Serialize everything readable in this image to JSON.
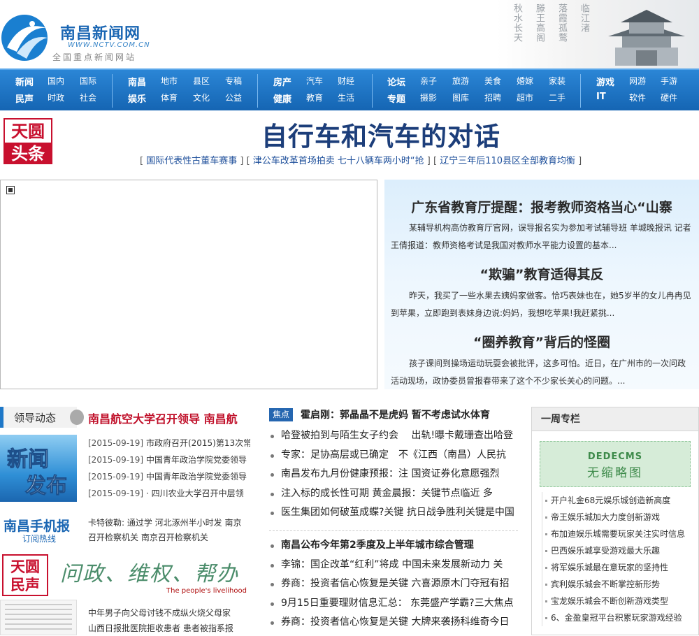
{
  "header": {
    "site_name": "南昌新闻网",
    "site_url": "WWW.NCTV.COM.CN",
    "slogan": "全国重点新闻网站",
    "banner_calligraphy": [
      "秋水长天",
      "滕王高阁",
      "落霞孤鹜",
      "临江渚"
    ]
  },
  "nav": {
    "groups": [
      {
        "rows": [
          [
            {
              "label": "新闻",
              "bold": true
            },
            {
              "label": "国内"
            },
            {
              "label": "国际"
            }
          ],
          [
            {
              "label": "民声",
              "bold": true
            },
            {
              "label": "时政"
            },
            {
              "label": "社会"
            }
          ]
        ]
      },
      {
        "rows": [
          [
            {
              "label": "南昌",
              "bold": true
            },
            {
              "label": "地市"
            },
            {
              "label": "县区"
            },
            {
              "label": "专稿"
            }
          ],
          [
            {
              "label": "娱乐",
              "bold": true
            },
            {
              "label": "体育"
            },
            {
              "label": "文化"
            },
            {
              "label": "公益"
            }
          ]
        ]
      },
      {
        "rows": [
          [
            {
              "label": "房产",
              "bold": true
            },
            {
              "label": "汽车"
            },
            {
              "label": "财经"
            }
          ],
          [
            {
              "label": "健康",
              "bold": true
            },
            {
              "label": "教育"
            },
            {
              "label": "生活"
            }
          ]
        ]
      },
      {
        "rows": [
          [
            {
              "label": "论坛",
              "bold": true
            },
            {
              "label": "亲子"
            },
            {
              "label": "旅游"
            },
            {
              "label": "美食"
            },
            {
              "label": "婚嫁"
            },
            {
              "label": "家装"
            }
          ],
          [
            {
              "label": "专题",
              "bold": true
            },
            {
              "label": "摄影"
            },
            {
              "label": "图库"
            },
            {
              "label": "招聘"
            },
            {
              "label": "超市"
            },
            {
              "label": "二手"
            }
          ]
        ]
      },
      {
        "rows": [
          [
            {
              "label": "游戏",
              "bold": true
            },
            {
              "label": "网游"
            },
            {
              "label": "手游"
            }
          ],
          [
            {
              "label": "IT",
              "bold": true
            },
            {
              "label": "软件"
            },
            {
              "label": "硬件"
            }
          ]
        ]
      }
    ]
  },
  "top_news": {
    "badge_line1": "天圆",
    "badge_line2": "头条",
    "headline": "自行车和汽车的对话",
    "sub_links": [
      "国际代表性古董车赛事",
      "津公车改革首场拍卖 七十八辆车两小时“抢",
      "辽宁三年后110县区全部教育均衡"
    ]
  },
  "edu": [
    {
      "title": "广东省教育厅提醒：报考教师资格当心“山寨",
      "text": "某辅导机构高仿教育厅官网，误导报名实为参加考试辅导班 羊城晚报讯 记者王倩报道：教师资格考试是我国对教师水平能力设置的基本..."
    },
    {
      "title": "“欺骗”教育适得其反",
      "text": "昨天，我买了一些水果去姨妈家做客。恰巧表妹也在，她5岁半的女儿冉冉见到苹果，立即跑到表妹身边说:妈妈，我想吃苹果!我赶紧挑..."
    },
    {
      "title": "“圈养教育”背后的怪圈",
      "text": "孩子课间到操场运动玩耍会被批评，这多可怕。近日，在广州市的一次问政活动现场，政协委员曾报春带来了这个不少家长关心的问题。..."
    }
  ],
  "leaders": {
    "section_title": "领导动态",
    "lead_link": "南昌航空大学召开领导 南昌航",
    "image_text_1": "新闻",
    "image_text_2": "发布",
    "items": [
      {
        "date": "[2015-09-19]",
        "text": "市政府召开(2015)第13次常"
      },
      {
        "date": "[2015-09-19]",
        "text": "中国青年政治学院党委领导"
      },
      {
        "date": "[2015-09-19]",
        "text": "中国青年政治学院党委领导"
      },
      {
        "date": "[2015-09-19]",
        "text": "· 四川农业大学召开中层领"
      }
    ]
  },
  "mobile": {
    "title": "南昌手机报",
    "subtitle": "订阅热线",
    "links": [
      "卡特彼勒: 通过学 河北涿州半小时发 南京",
      "召开检察机关 南京召开检察机关"
    ]
  },
  "people": {
    "badge_line1": "天圆",
    "badge_line2": "民声",
    "slogan": "问政、维权、帮办",
    "slogan_en": "The people's livelihood",
    "links": [
      "中年男子向父母讨钱不成纵火烧父母家",
      "山西日报批医院拒收患者 患者被指系报"
    ]
  },
  "focus": {
    "tag": "焦点",
    "title": "霍启刚：郭晶晶不是虎妈 暂不考虑试水体育",
    "items_a": [
      {
        "text": "哈登被拍到与陌生女子约会　 出轨!曝卡戴珊查出哈登"
      },
      {
        "text": "专家：足协高层或已确定　不《江西（南昌）人民抗"
      },
      {
        "text": "南昌发布九月份健康预报：注 国资证券化意愿强烈"
      },
      {
        "text": "注入标的成长性可期 黄金晨报：关键节点临近 多"
      },
      {
        "text": "医生集团如何破茧成蝶?关键 抗日战争胜利关键是中国"
      }
    ],
    "items_b": [
      {
        "text": "南昌公布今年第2季度及上半年城市综合管理",
        "strong": true
      },
      {
        "text": "李锦：国企改革“红利”将成 中国未来发展新动力 关"
      },
      {
        "text": "券商：投资者信心恢复是关键 六喜源原木门夺冠有招"
      },
      {
        "text": "9月15日重要理财信息汇总： 东莞盛产学霸?三大焦点"
      },
      {
        "text": "券商：投资者信心恢复是关键 大牌来袭扬科维奇今日"
      }
    ]
  },
  "week": {
    "title": "一周专栏",
    "ad_line1": "DEDECMS",
    "ad_line2": "无缩略图",
    "items": [
      "开户礼金68元娱乐城创造新高度",
      "帝王娱乐城加大力度创新游戏",
      "布加迪娱乐城需要玩家关注实时信息",
      "巴西娱乐城享受游戏最大乐趣",
      "将军娱乐城最在意玩家的坚持性",
      "宾利娱乐城会不断掌控新形势",
      "宝龙娱乐城会不断创新游戏类型",
      "6、金盈皇冠平台积累玩家游戏经验"
    ]
  },
  "colors": {
    "brand_blue": "#1a66b3",
    "nav_blue": "#1e78c8",
    "headline": "#1c3e7a",
    "lead_red": "#c0102a"
  }
}
